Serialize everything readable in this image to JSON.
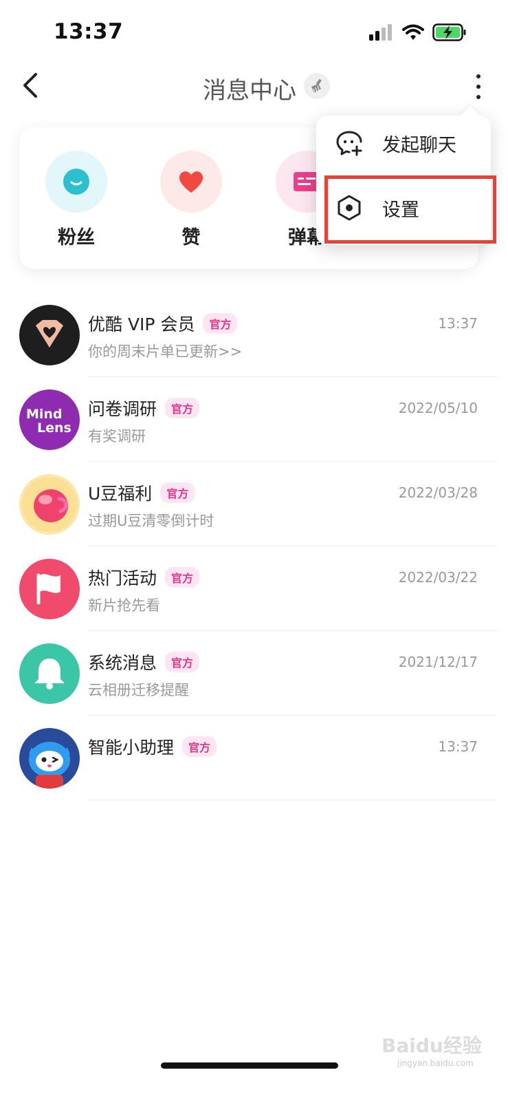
{
  "status_bar": {
    "time": "13:37"
  },
  "header": {
    "title": "消息中心"
  },
  "shortcuts": [
    {
      "label": "粉丝",
      "icon": "smile-face-icon",
      "color": "#2bbfd0",
      "bg": "#e3f6f9"
    },
    {
      "label": "赞",
      "icon": "heart-icon",
      "color": "#f1493f",
      "bg": "#fde9e7"
    },
    {
      "label": "弹幕",
      "icon": "danmaku-icon",
      "color": "#ec3f8c",
      "bg": "#fce6f0"
    }
  ],
  "menu": {
    "items": [
      {
        "label": "发起聊天",
        "icon": "chat-add-icon"
      },
      {
        "label": "设置",
        "icon": "settings-hex-icon"
      }
    ]
  },
  "messages": [
    {
      "name": "优酷 VIP 会员",
      "badge": "官方",
      "preview": "你的周末片单已更新>>",
      "time": "13:37"
    },
    {
      "name": "问卷调研",
      "badge": "官方",
      "preview": "有奖调研",
      "time": "2022/05/10",
      "avatar_text_1": "Mind",
      "avatar_text_2": "Lens"
    },
    {
      "name": "U豆福利",
      "badge": "官方",
      "preview": "过期U豆清零倒计时",
      "time": "2022/03/28"
    },
    {
      "name": "热门活动",
      "badge": "官方",
      "preview": "新片抢先看",
      "time": "2022/03/22"
    },
    {
      "name": "系统消息",
      "badge": "官方",
      "preview": "云相册迁移提醒",
      "time": "2021/12/17"
    },
    {
      "name": "智能小助理",
      "badge": "官方",
      "preview": "",
      "time": "13:37"
    }
  ],
  "watermark": {
    "text": "Baidu经验",
    "sub": "jingyan.baidu.com"
  }
}
